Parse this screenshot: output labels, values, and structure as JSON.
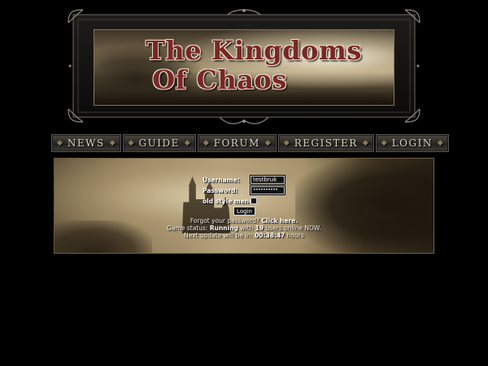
{
  "banner": {
    "logo_line1": "The Kingdoms",
    "logo_line2": "Of Chaos"
  },
  "nav": {
    "items": [
      {
        "label": "NEWS"
      },
      {
        "label": "GUIDE"
      },
      {
        "label": "FORUM"
      },
      {
        "label": "REGISTER"
      },
      {
        "label": "LOGIN"
      }
    ]
  },
  "login": {
    "username_label": "Username:",
    "username_value": "testbruk",
    "password_label": "Password:",
    "password_value": "••••••••••",
    "old_style_label": "old style menu",
    "old_style_checked": false,
    "button_label": "Login",
    "forgot_text": "Forgot your password?",
    "forgot_link": "Click here.",
    "status_prefix": "Game status:",
    "status_value": "Running",
    "status_with": "with",
    "users_count": "19",
    "users_suffix": "users online NOW.",
    "update_prefix": "Next update will be in:",
    "update_time": "00:38:47",
    "update_suffix": "hours"
  },
  "colors": {
    "background": "#000000",
    "logo_text": "#7a2626",
    "nav_text": "#d9d2bf"
  }
}
